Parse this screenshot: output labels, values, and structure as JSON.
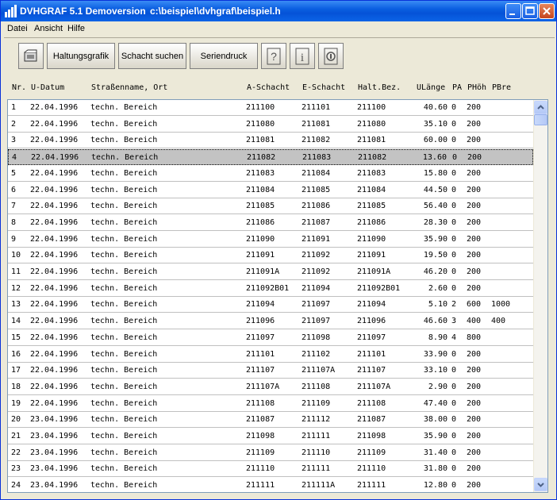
{
  "window": {
    "title": "DVHGRAF 5.1 Demoversion",
    "path": "c:\\beispiel\\dvhgraf\\beispiel.h"
  },
  "menu": [
    "Datei",
    "Ansicht",
    "Hilfe"
  ],
  "toolbar": {
    "open_icon": "open-folder-icon",
    "haltungsgrafik": "Haltungsgrafik",
    "schacht_suchen": "Schacht suchen",
    "seriendruck": "Seriendruck",
    "help_icon": "question-icon",
    "info_icon": "info-icon",
    "about_icon": "about-icon"
  },
  "columns": {
    "nr": "Nr.",
    "datum": "U-Datum",
    "strasse": "Straßenname, Ort",
    "a_schacht": "A-Schacht",
    "e_schacht": "E-Schacht",
    "halt": "Halt.Bez.",
    "ulaenge": "ULänge",
    "pa": "PA",
    "phoeh": "PHöh",
    "pbre": "PBre"
  },
  "selected_row": 4,
  "rows": [
    {
      "nr": "1",
      "datum": "22.04.1996",
      "strasse": "techn. Bereich",
      "a": "211100",
      "e": "211101",
      "halt": "211100",
      "ul": "40.60",
      "pa": "0",
      "ph": "200",
      "pb": ""
    },
    {
      "nr": "2",
      "datum": "22.04.1996",
      "strasse": "techn. Bereich",
      "a": "211080",
      "e": "211081",
      "halt": "211080",
      "ul": "35.10",
      "pa": "0",
      "ph": "200",
      "pb": ""
    },
    {
      "nr": "3",
      "datum": "22.04.1996",
      "strasse": "techn. Bereich",
      "a": "211081",
      "e": "211082",
      "halt": "211081",
      "ul": "60.00",
      "pa": "0",
      "ph": "200",
      "pb": ""
    },
    {
      "nr": "4",
      "datum": "22.04.1996",
      "strasse": "techn. Bereich",
      "a": "211082",
      "e": "211083",
      "halt": "211082",
      "ul": "13.60",
      "pa": "0",
      "ph": "200",
      "pb": ""
    },
    {
      "nr": "5",
      "datum": "22.04.1996",
      "strasse": "techn. Bereich",
      "a": "211083",
      "e": "211084",
      "halt": "211083",
      "ul": "15.80",
      "pa": "0",
      "ph": "200",
      "pb": ""
    },
    {
      "nr": "6",
      "datum": "22.04.1996",
      "strasse": "techn. Bereich",
      "a": "211084",
      "e": "211085",
      "halt": "211084",
      "ul": "44.50",
      "pa": "0",
      "ph": "200",
      "pb": ""
    },
    {
      "nr": "7",
      "datum": "22.04.1996",
      "strasse": "techn. Bereich",
      "a": "211085",
      "e": "211086",
      "halt": "211085",
      "ul": "56.40",
      "pa": "0",
      "ph": "200",
      "pb": ""
    },
    {
      "nr": "8",
      "datum": "22.04.1996",
      "strasse": "techn. Bereich",
      "a": "211086",
      "e": "211087",
      "halt": "211086",
      "ul": "28.30",
      "pa": "0",
      "ph": "200",
      "pb": ""
    },
    {
      "nr": "9",
      "datum": "22.04.1996",
      "strasse": "techn. Bereich",
      "a": "211090",
      "e": "211091",
      "halt": "211090",
      "ul": "35.90",
      "pa": "0",
      "ph": "200",
      "pb": ""
    },
    {
      "nr": "10",
      "datum": "22.04.1996",
      "strasse": "techn. Bereich",
      "a": "211091",
      "e": "211092",
      "halt": "211091",
      "ul": "19.50",
      "pa": "0",
      "ph": "200",
      "pb": ""
    },
    {
      "nr": "11",
      "datum": "22.04.1996",
      "strasse": "techn. Bereich",
      "a": "211091A",
      "e": "211092",
      "halt": "211091A",
      "ul": "46.20",
      "pa": "0",
      "ph": "200",
      "pb": ""
    },
    {
      "nr": "12",
      "datum": "22.04.1996",
      "strasse": "techn. Bereich",
      "a": "211092B01",
      "e": "211094",
      "halt": "211092B01",
      "ul": "2.60",
      "pa": "0",
      "ph": "200",
      "pb": ""
    },
    {
      "nr": "13",
      "datum": "22.04.1996",
      "strasse": "techn. Bereich",
      "a": "211094",
      "e": "211097",
      "halt": "211094",
      "ul": "5.10",
      "pa": "2",
      "ph": "600",
      "pb": "1000"
    },
    {
      "nr": "14",
      "datum": "22.04.1996",
      "strasse": "techn. Bereich",
      "a": "211096",
      "e": "211097",
      "halt": "211096",
      "ul": "46.60",
      "pa": "3",
      "ph": "400",
      "pb": "400"
    },
    {
      "nr": "15",
      "datum": "22.04.1996",
      "strasse": "techn. Bereich",
      "a": "211097",
      "e": "211098",
      "halt": "211097",
      "ul": "8.90",
      "pa": "4",
      "ph": "800",
      "pb": ""
    },
    {
      "nr": "16",
      "datum": "22.04.1996",
      "strasse": "techn. Bereich",
      "a": "211101",
      "e": "211102",
      "halt": "211101",
      "ul": "33.90",
      "pa": "0",
      "ph": "200",
      "pb": ""
    },
    {
      "nr": "17",
      "datum": "22.04.1996",
      "strasse": "techn. Bereich",
      "a": "211107",
      "e": "211107A",
      "halt": "211107",
      "ul": "33.10",
      "pa": "0",
      "ph": "200",
      "pb": ""
    },
    {
      "nr": "18",
      "datum": "22.04.1996",
      "strasse": "techn. Bereich",
      "a": "211107A",
      "e": "211108",
      "halt": "211107A",
      "ul": "2.90",
      "pa": "0",
      "ph": "200",
      "pb": ""
    },
    {
      "nr": "19",
      "datum": "22.04.1996",
      "strasse": "techn. Bereich",
      "a": "211108",
      "e": "211109",
      "halt": "211108",
      "ul": "47.40",
      "pa": "0",
      "ph": "200",
      "pb": ""
    },
    {
      "nr": "20",
      "datum": "23.04.1996",
      "strasse": "techn. Bereich",
      "a": "211087",
      "e": "211112",
      "halt": "211087",
      "ul": "38.00",
      "pa": "0",
      "ph": "200",
      "pb": ""
    },
    {
      "nr": "21",
      "datum": "23.04.1996",
      "strasse": "techn. Bereich",
      "a": "211098",
      "e": "211111",
      "halt": "211098",
      "ul": "35.90",
      "pa": "0",
      "ph": "200",
      "pb": ""
    },
    {
      "nr": "22",
      "datum": "23.04.1996",
      "strasse": "techn. Bereich",
      "a": "211109",
      "e": "211110",
      "halt": "211109",
      "ul": "31.40",
      "pa": "0",
      "ph": "200",
      "pb": ""
    },
    {
      "nr": "23",
      "datum": "23.04.1996",
      "strasse": "techn. Bereich",
      "a": "211110",
      "e": "211111",
      "halt": "211110",
      "ul": "31.80",
      "pa": "0",
      "ph": "200",
      "pb": ""
    },
    {
      "nr": "24",
      "datum": "23.04.1996",
      "strasse": "techn. Bereich",
      "a": "211111",
      "e": "211111A",
      "halt": "211111",
      "ul": "12.80",
      "pa": "0",
      "ph": "200",
      "pb": ""
    }
  ]
}
